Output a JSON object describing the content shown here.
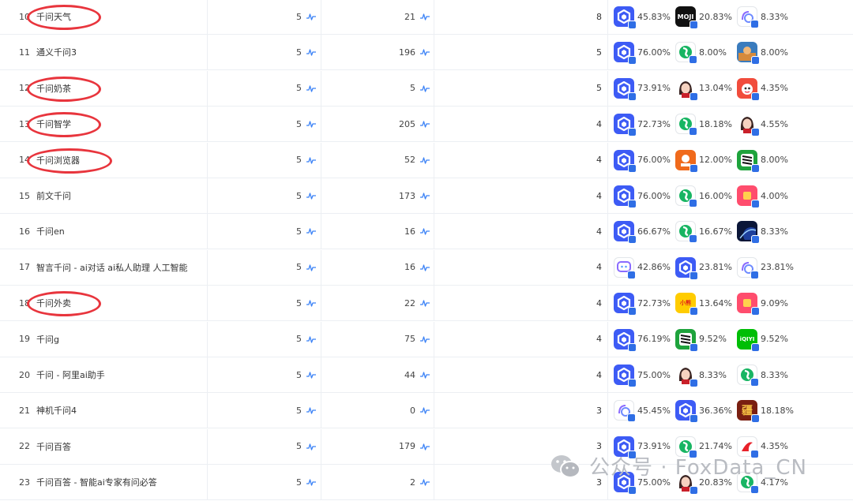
{
  "rows": [
    {
      "rank": "10",
      "name": "千问天气",
      "v1": "5",
      "v2": "21",
      "v3": "8",
      "highlight": true,
      "comps": [
        {
          "icon": "qwen-icon",
          "pct": "45.83%"
        },
        {
          "icon": "moji-icon",
          "pct": "20.83%"
        },
        {
          "icon": "doubao-icon",
          "pct": "8.33%"
        }
      ]
    },
    {
      "rank": "11",
      "name": "通义千问3",
      "v1": "5",
      "v2": "196",
      "v3": "5",
      "highlight": false,
      "comps": [
        {
          "icon": "qwen-icon",
          "pct": "76.00%"
        },
        {
          "icon": "tongyi-icon",
          "pct": "8.00%"
        },
        {
          "icon": "game-icon",
          "pct": "8.00%"
        }
      ]
    },
    {
      "rank": "12",
      "name": "千问奶茶",
      "v1": "5",
      "v2": "5",
      "v3": "5",
      "highlight": true,
      "comps": [
        {
          "icon": "qwen-icon",
          "pct": "73.91%"
        },
        {
          "icon": "girl-icon",
          "pct": "13.04%"
        },
        {
          "icon": "red-app-icon",
          "pct": "4.35%"
        }
      ]
    },
    {
      "rank": "13",
      "name": "千问智学",
      "v1": "5",
      "v2": "205",
      "v3": "4",
      "highlight": true,
      "comps": [
        {
          "icon": "qwen-icon",
          "pct": "72.73%"
        },
        {
          "icon": "tongyi-icon",
          "pct": "18.18%"
        },
        {
          "icon": "girl-icon",
          "pct": "4.55%"
        }
      ]
    },
    {
      "rank": "14",
      "name": "千问浏览器",
      "v1": "5",
      "v2": "52",
      "v3": "4",
      "highlight": true,
      "comps": [
        {
          "icon": "qwen-icon",
          "pct": "76.00%"
        },
        {
          "icon": "orange-app-icon",
          "pct": "12.00%"
        },
        {
          "icon": "zebra-icon",
          "pct": "8.00%"
        }
      ]
    },
    {
      "rank": "15",
      "name": "前文千问",
      "v1": "5",
      "v2": "173",
      "v3": "4",
      "highlight": false,
      "comps": [
        {
          "icon": "qwen-icon",
          "pct": "76.00%"
        },
        {
          "icon": "tongyi-icon",
          "pct": "16.00%"
        },
        {
          "icon": "pink-app-icon",
          "pct": "4.00%"
        }
      ]
    },
    {
      "rank": "16",
      "name": "千问en",
      "v1": "5",
      "v2": "16",
      "v3": "4",
      "highlight": false,
      "comps": [
        {
          "icon": "qwen-icon",
          "pct": "66.67%"
        },
        {
          "icon": "tongyi-icon",
          "pct": "16.67%"
        },
        {
          "icon": "planet-icon",
          "pct": "8.33%"
        }
      ]
    },
    {
      "rank": "17",
      "name": "智言千问 - ai对话 ai私人助理 人工智能",
      "v1": "5",
      "v2": "16",
      "v3": "4",
      "highlight": false,
      "comps": [
        {
          "icon": "chatbot-icon",
          "pct": "42.86%"
        },
        {
          "icon": "qwen-icon",
          "pct": "23.81%"
        },
        {
          "icon": "doubao-icon",
          "pct": "23.81%"
        }
      ]
    },
    {
      "rank": "18",
      "name": "千问外卖",
      "v1": "5",
      "v2": "22",
      "v3": "4",
      "highlight": true,
      "comps": [
        {
          "icon": "qwen-icon",
          "pct": "72.73%"
        },
        {
          "icon": "xiaobai-icon",
          "pct": "13.64%"
        },
        {
          "icon": "pink-app-icon",
          "pct": "9.09%"
        }
      ]
    },
    {
      "rank": "19",
      "name": "千问g",
      "v1": "5",
      "v2": "75",
      "v3": "4",
      "highlight": false,
      "comps": [
        {
          "icon": "qwen-icon",
          "pct": "76.19%"
        },
        {
          "icon": "zebra-icon",
          "pct": "9.52%"
        },
        {
          "icon": "iqiyi-icon",
          "pct": "9.52%"
        }
      ]
    },
    {
      "rank": "20",
      "name": "千问 - 阿里ai助手",
      "v1": "5",
      "v2": "44",
      "v3": "4",
      "highlight": false,
      "comps": [
        {
          "icon": "qwen-icon",
          "pct": "75.00%"
        },
        {
          "icon": "girl-icon",
          "pct": "8.33%"
        },
        {
          "icon": "tongyi-icon",
          "pct": "8.33%"
        }
      ]
    },
    {
      "rank": "21",
      "name": "神机千问4",
      "v1": "5",
      "v2": "0",
      "v3": "3",
      "highlight": false,
      "comps": [
        {
          "icon": "doubao-icon",
          "pct": "45.45%"
        },
        {
          "icon": "qwen-icon",
          "pct": "36.36%"
        },
        {
          "icon": "calligraphy-icon",
          "pct": "18.18%"
        }
      ]
    },
    {
      "rank": "22",
      "name": "千问百答",
      "v1": "5",
      "v2": "179",
      "v3": "3",
      "highlight": false,
      "comps": [
        {
          "icon": "qwen-icon",
          "pct": "73.91%"
        },
        {
          "icon": "tongyi-icon",
          "pct": "21.74%"
        },
        {
          "icon": "fire-icon",
          "pct": "4.35%"
        }
      ]
    },
    {
      "rank": "23",
      "name": "千问百答 - 智能ai专家有问必答",
      "v1": "5",
      "v2": "2",
      "v3": "3",
      "highlight": false,
      "comps": [
        {
          "icon": "qwen-icon",
          "pct": "75.00%"
        },
        {
          "icon": "girl-icon",
          "pct": "20.83%"
        },
        {
          "icon": "tongyi-icon",
          "pct": "4.17%"
        }
      ]
    }
  ],
  "icon_text": {
    "moji": "MOJI",
    "xiaobai": "小熊",
    "iqiyi": "iQIYI",
    "calligraphy": "疆"
  },
  "watermark": {
    "text": "公众号 · FoxData_CN",
    "icon": "wechat-icon"
  },
  "colors": {
    "highlight_circle": "#e8353d",
    "qwen_blue": "#3d5bf5",
    "trend_blue": "#3b82f6",
    "divider": "#eceff3"
  }
}
